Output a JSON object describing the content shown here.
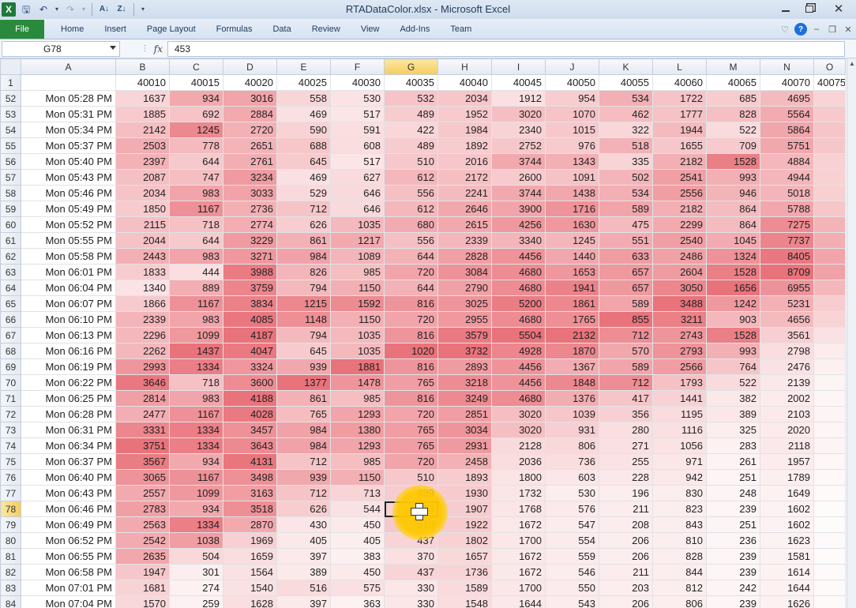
{
  "window": {
    "title": "RTADataColor.xlsx - Microsoft Excel"
  },
  "qat": {
    "app_icon_letter": "X",
    "icons": [
      "save-icon",
      "undo-icon",
      "dropdown-icon",
      "redo-icon",
      "sort-ascending-icon",
      "sort-descending-icon",
      "customize-qat-icon"
    ]
  },
  "ribbon": {
    "tabs": [
      "File",
      "Home",
      "Insert",
      "Page Layout",
      "Formulas",
      "Data",
      "Review",
      "View",
      "Add-Ins",
      "Team"
    ]
  },
  "formula_bar": {
    "name_box": "G78",
    "fx_label": "fx",
    "formula": "453"
  },
  "sheet": {
    "columns": [
      "A",
      "B",
      "C",
      "D",
      "E",
      "F",
      "G",
      "H",
      "I",
      "J",
      "K",
      "L",
      "M",
      "N",
      "O"
    ],
    "selected_column": "G",
    "selected_row": "78",
    "header_row": {
      "row": "1",
      "values": [
        "",
        "40010",
        "40015",
        "40020",
        "40025",
        "40030",
        "40035",
        "40040",
        "40045",
        "40050",
        "40055",
        "40060",
        "40065",
        "40070",
        "40075"
      ]
    },
    "rows": [
      {
        "row": "52",
        "label": "Mon 05:28 PM",
        "values": [
          1637,
          934,
          3016,
          558,
          530,
          532,
          2034,
          1912,
          954,
          534,
          1722,
          685,
          4695
        ]
      },
      {
        "row": "53",
        "label": "Mon 05:31 PM",
        "values": [
          1885,
          692,
          2884,
          469,
          517,
          489,
          1952,
          3020,
          1070,
          462,
          1777,
          828,
          5564
        ]
      },
      {
        "row": "54",
        "label": "Mon 05:34 PM",
        "values": [
          2142,
          1245,
          2720,
          590,
          591,
          422,
          1984,
          2340,
          1015,
          322,
          1944,
          522,
          5864
        ]
      },
      {
        "row": "55",
        "label": "Mon 05:37 PM",
        "values": [
          2503,
          778,
          2651,
          688,
          608,
          489,
          1892,
          2752,
          976,
          518,
          1655,
          709,
          5751
        ]
      },
      {
        "row": "56",
        "label": "Mon 05:40 PM",
        "values": [
          2397,
          644,
          2761,
          645,
          517,
          510,
          2016,
          3744,
          1343,
          335,
          2182,
          1528,
          4884
        ]
      },
      {
        "row": "57",
        "label": "Mon 05:43 PM",
        "values": [
          2087,
          747,
          3234,
          469,
          627,
          612,
          2172,
          2600,
          1091,
          502,
          2541,
          993,
          4944
        ]
      },
      {
        "row": "58",
        "label": "Mon 05:46 PM",
        "values": [
          2034,
          983,
          3033,
          529,
          646,
          556,
          2241,
          3744,
          1438,
          534,
          2556,
          946,
          5018
        ]
      },
      {
        "row": "59",
        "label": "Mon 05:49 PM",
        "values": [
          1850,
          1167,
          2736,
          712,
          646,
          612,
          2646,
          3900,
          1716,
          589,
          2182,
          864,
          5788
        ]
      },
      {
        "row": "60",
        "label": "Mon 05:52 PM",
        "values": [
          2115,
          718,
          2774,
          626,
          1035,
          680,
          2615,
          4256,
          1630,
          475,
          2299,
          864,
          7275
        ]
      },
      {
        "row": "61",
        "label": "Mon 05:55 PM",
        "values": [
          2044,
          644,
          3229,
          861,
          1217,
          556,
          2339,
          3340,
          1245,
          551,
          2540,
          1045,
          7737
        ]
      },
      {
        "row": "62",
        "label": "Mon 05:58 PM",
        "values": [
          2443,
          983,
          3271,
          984,
          1089,
          644,
          2828,
          4456,
          1440,
          633,
          2486,
          1324,
          8405
        ]
      },
      {
        "row": "63",
        "label": "Mon 06:01 PM",
        "values": [
          1833,
          444,
          3988,
          826,
          985,
          720,
          3084,
          4680,
          1653,
          657,
          2604,
          1528,
          8709
        ]
      },
      {
        "row": "64",
        "label": "Mon 06:04 PM",
        "values": [
          1340,
          889,
          3759,
          794,
          1150,
          644,
          2790,
          4680,
          1941,
          657,
          3050,
          1656,
          6955
        ]
      },
      {
        "row": "65",
        "label": "Mon 06:07 PM",
        "values": [
          1866,
          1167,
          3834,
          1215,
          1592,
          816,
          3025,
          5200,
          1861,
          589,
          3488,
          1242,
          5231
        ]
      },
      {
        "row": "66",
        "label": "Mon 06:10 PM",
        "values": [
          2339,
          983,
          4085,
          1148,
          1150,
          720,
          2955,
          4680,
          1765,
          855,
          3211,
          903,
          4656
        ]
      },
      {
        "row": "67",
        "label": "Mon 06:13 PM",
        "values": [
          2296,
          1099,
          4187,
          794,
          1035,
          816,
          3579,
          5504,
          2132,
          712,
          2743,
          1528,
          3561
        ]
      },
      {
        "row": "68",
        "label": "Mon 06:16 PM",
        "values": [
          2262,
          1437,
          4047,
          645,
          1035,
          1020,
          3732,
          4928,
          1870,
          570,
          2793,
          993,
          2798
        ]
      },
      {
        "row": "69",
        "label": "Mon 06:19 PM",
        "values": [
          2993,
          1334,
          3324,
          939,
          1881,
          816,
          2893,
          4456,
          1367,
          589,
          2566,
          764,
          2476
        ]
      },
      {
        "row": "70",
        "label": "Mon 06:22 PM",
        "values": [
          3646,
          718,
          3600,
          1377,
          1478,
          765,
          3218,
          4456,
          1848,
          712,
          1793,
          522,
          2139
        ]
      },
      {
        "row": "71",
        "label": "Mon 06:25 PM",
        "values": [
          2814,
          983,
          4188,
          861,
          985,
          816,
          3249,
          4680,
          1376,
          417,
          1441,
          382,
          2002
        ]
      },
      {
        "row": "72",
        "label": "Mon 06:28 PM",
        "values": [
          2477,
          1167,
          4028,
          765,
          1293,
          720,
          2851,
          3020,
          1039,
          356,
          1195,
          389,
          2103
        ]
      },
      {
        "row": "73",
        "label": "Mon 06:31 PM",
        "values": [
          3331,
          1334,
          3457,
          984,
          1380,
          765,
          3034,
          3020,
          931,
          280,
          1116,
          325,
          2020
        ]
      },
      {
        "row": "74",
        "label": "Mon 06:34 PM",
        "values": [
          3751,
          1334,
          3643,
          984,
          1293,
          765,
          2931,
          2128,
          806,
          271,
          1056,
          283,
          2118
        ]
      },
      {
        "row": "75",
        "label": "Mon 06:37 PM",
        "values": [
          3567,
          934,
          4131,
          712,
          985,
          720,
          2458,
          2036,
          736,
          255,
          971,
          261,
          1957
        ]
      },
      {
        "row": "76",
        "label": "Mon 06:40 PM",
        "values": [
          3065,
          1167,
          3498,
          939,
          1150,
          510,
          1893,
          1800,
          603,
          228,
          942,
          251,
          1789
        ]
      },
      {
        "row": "77",
        "label": "Mon 06:43 PM",
        "values": [
          2557,
          1099,
          3163,
          712,
          713,
          489,
          1930,
          1732,
          530,
          196,
          830,
          248,
          1649
        ]
      },
      {
        "row": "78",
        "label": "Mon 06:46 PM",
        "values": [
          2783,
          934,
          3518,
          626,
          544,
          453,
          1907,
          1768,
          576,
          211,
          823,
          239,
          1602
        ]
      },
      {
        "row": "79",
        "label": "Mon 06:49 PM",
        "values": [
          2563,
          1334,
          2870,
          430,
          450,
          510,
          1922,
          1672,
          547,
          208,
          843,
          251,
          1602
        ]
      },
      {
        "row": "80",
        "label": "Mon 06:52 PM",
        "values": [
          2542,
          1038,
          1969,
          405,
          405,
          437,
          1802,
          1700,
          554,
          206,
          810,
          236,
          1623
        ]
      },
      {
        "row": "81",
        "label": "Mon 06:55 PM",
        "values": [
          2635,
          504,
          1659,
          397,
          383,
          370,
          1657,
          1672,
          559,
          206,
          828,
          239,
          1581
        ]
      },
      {
        "row": "82",
        "label": "Mon 06:58 PM",
        "values": [
          1947,
          301,
          1564,
          389,
          450,
          437,
          1736,
          1672,
          546,
          211,
          844,
          239,
          1614
        ]
      },
      {
        "row": "83",
        "label": "Mon 07:01 PM",
        "values": [
          1681,
          274,
          1540,
          516,
          575,
          330,
          1589,
          1700,
          550,
          203,
          812,
          242,
          1644
        ]
      },
      {
        "row": "84",
        "label": "Mon 07:04 PM",
        "values": [
          1570,
          259,
          1628,
          397,
          363,
          330,
          1548,
          1644,
          543,
          206,
          806,
          239,
          1626
        ]
      }
    ]
  },
  "colors": {
    "heat_high": "#e9737b",
    "heat_low": "#ffffff",
    "file_tab": "#2a8a3c",
    "selection_header": "#f5cd5e"
  }
}
